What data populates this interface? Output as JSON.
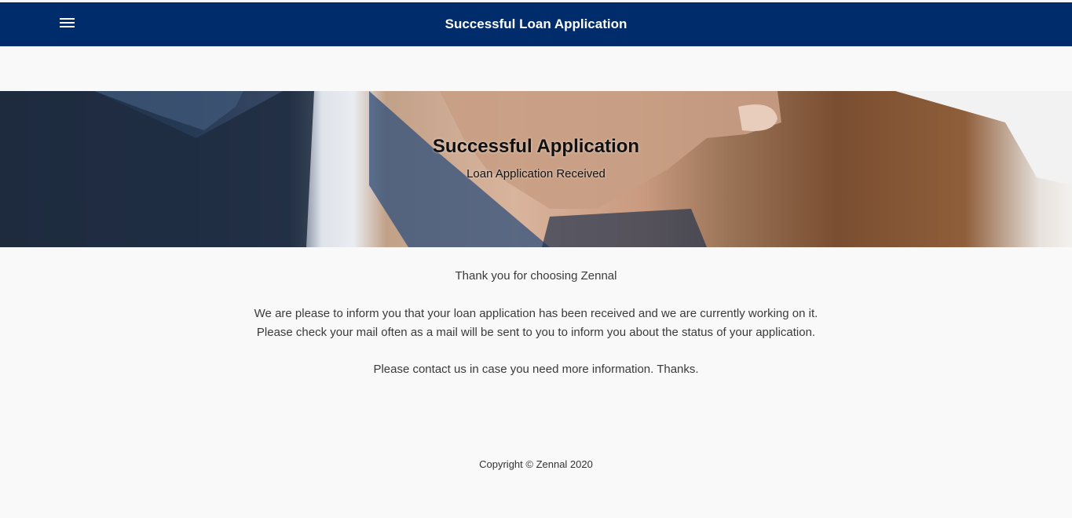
{
  "header": {
    "menu_icon": "hamburger-menu-icon",
    "title": "Successful Loan Application",
    "background": "#002c6b"
  },
  "hero": {
    "title": "Successful Application",
    "subtitle": "Loan Application Received"
  },
  "main": {
    "thanks": "Thank you for choosing Zennal",
    "info_line1": "We are please to inform you that your loan application has been received and we are currently working on it.",
    "info_line2": "Please check your mail often as a mail will be sent to you to inform you about the status of your application.",
    "contact": "Please contact us in case you need more information. Thanks."
  },
  "footer": {
    "copyright": "Copyright © Zennal 2020"
  }
}
